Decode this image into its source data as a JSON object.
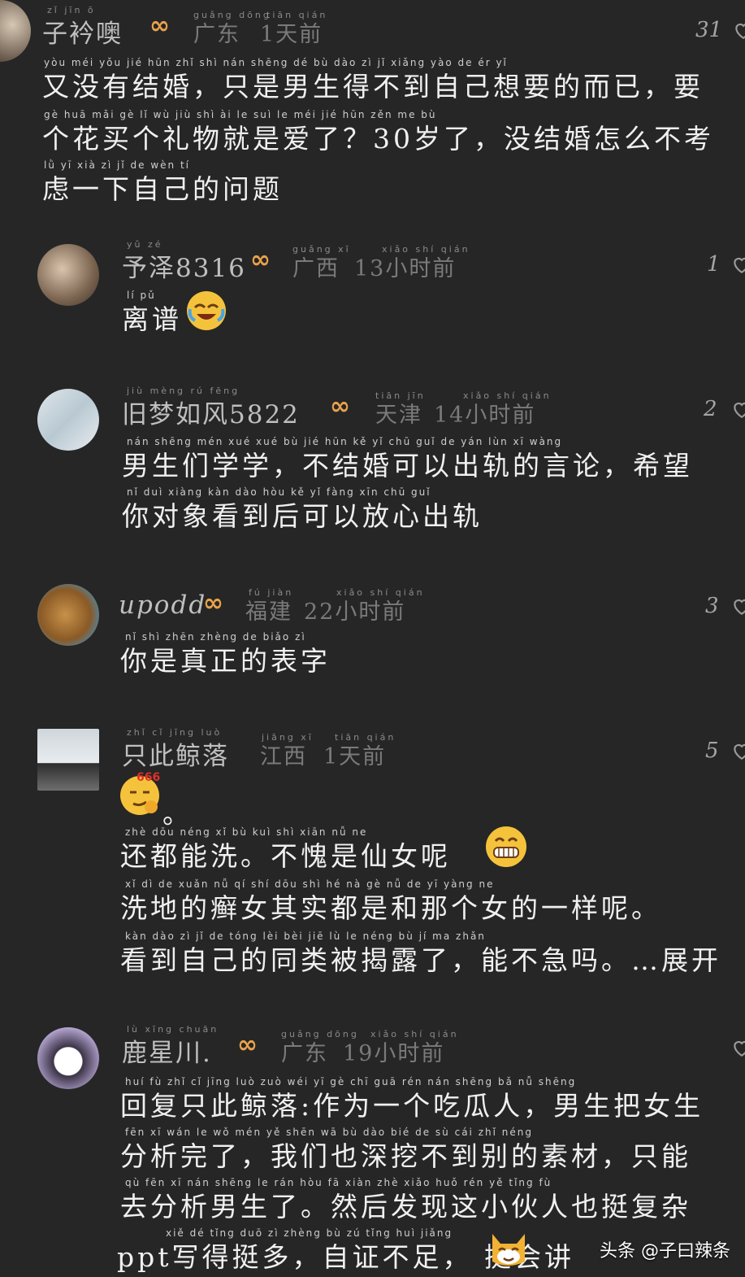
{
  "comments": [
    {
      "username": "子衿噢",
      "username_pinyin": "zǐ jīn ō",
      "badge": "∞",
      "location": "广东",
      "location_pinyin": "guǎng dōng",
      "time": "1天前",
      "time_pinyin": "tiān qián",
      "likes": "31",
      "lines": [
        {
          "text": "又没有结婚，只是男生得不到自己想要的而已，要",
          "pinyin": "yòu méi yǒu jié hūn    zhǐ shì nán shēng dé bù dào zì jǐ xiǎng yào de ér yǐ"
        },
        {
          "text": "个花买个礼物就是爱了？30岁了，没结婚怎么不考",
          "pinyin": "gè huā mǎi gè lǐ wù jiù shì ài le    suì le    méi jié hūn zěn me bù"
        },
        {
          "text": "虑一下自己的问题",
          "pinyin": "lǜ yī xià zì jǐ de wèn tí"
        }
      ]
    },
    {
      "username": "予泽8316",
      "username_pinyin": "yǔ zé",
      "badge": "∞",
      "location": "广西",
      "location_pinyin": "guǎng xī",
      "time": "13小时前",
      "time_pinyin": "xiǎo shí qián",
      "likes": "1",
      "lines": [
        {
          "text": "离谱",
          "pinyin": "lí pǔ"
        }
      ]
    },
    {
      "username": "旧梦如风5822",
      "username_pinyin": "jiù mèng rú fēng",
      "badge": "∞",
      "location": "天津",
      "location_pinyin": "tiān jīn",
      "time": "14小时前",
      "time_pinyin": "xiǎo shí qián",
      "likes": "2",
      "lines": [
        {
          "text": "男生们学学，不结婚可以出轨的言论，希望",
          "pinyin": "nán shēng mén xué xué    bù jié hūn kě yǐ chū guǐ de yán lùn    xī wàng"
        },
        {
          "text": "你对象看到后可以放心出轨",
          "pinyin": "nǐ duì xiàng kàn dào hòu kě yǐ fàng xīn chū guǐ"
        }
      ]
    },
    {
      "username": "upodd",
      "username_pinyin": "",
      "badge": "∞",
      "location": "福建",
      "location_pinyin": "fú jiàn",
      "time": "22小时前",
      "time_pinyin": "xiǎo shí qián",
      "likes": "3",
      "lines": [
        {
          "text": "你是真正的表字",
          "pinyin": "nǐ shì zhēn zhèng de biǎo zì"
        }
      ]
    },
    {
      "username": "只此鲸落",
      "username_pinyin": "zhǐ cǐ jīng luò",
      "badge": "",
      "location": "江西",
      "location_pinyin": "jiāng xī",
      "time": "1天前",
      "time_pinyin": "tiān qián",
      "likes": "5",
      "emoji_label": "666",
      "lines": [
        {
          "text": "。",
          "pinyin": ""
        },
        {
          "text": "还都能洗。不愧是仙女呢",
          "pinyin": "zhè dōu néng xǐ    bù kuì shì xiān nǚ ne"
        },
        {
          "text": "洗地的癣女其实都是和那个女的一样呢。",
          "pinyin": "xǐ dì de xuǎn nǚ qí shí dōu shì hé nà gè nǚ de yī yàng ne"
        },
        {
          "text": "看到自己的同类被揭露了，能不急吗。…展开",
          "pinyin": "kàn dào zì jǐ de tóng lèi bèi jiē lù le    néng bù jí ma    zhǎn"
        }
      ]
    },
    {
      "username": "鹿星川.",
      "username_pinyin": "lù xīng chuān",
      "badge": "∞",
      "location": "广东",
      "location_pinyin": "guǎng dōng",
      "time": "19小时前",
      "time_pinyin": "xiǎo shí qián",
      "likes": "",
      "lines": [
        {
          "text": "回复只此鲸落:作为一个吃瓜人，男生把女生",
          "pinyin": "huí fù zhǐ cǐ jīng luò zuò wéi yī gè chī guā rén    nán shēng bǎ nǚ shēng"
        },
        {
          "text": "分析完了，我们也深挖不到别的素材，只能",
          "pinyin": "fēn xī wán le    wǒ mén yě shēn wā bù dào bié de sù cái    zhǐ néng"
        },
        {
          "text": "去分析男生了。然后发现这小伙人也挺复杂",
          "pinyin": "qù fēn xī nán shēng le    rán hòu fā xiàn zhè xiǎo huǒ rén yě tǐng fù"
        },
        {
          "text": "ppt写得挺多，自证不足，  挺会讲",
          "pinyin": "xiě dé tǐng duō    zì zhèng bù zú    tǐng huì jiǎng"
        }
      ]
    }
  ],
  "watermark": "头条 @子曰辣条",
  "expand_label": "展开"
}
